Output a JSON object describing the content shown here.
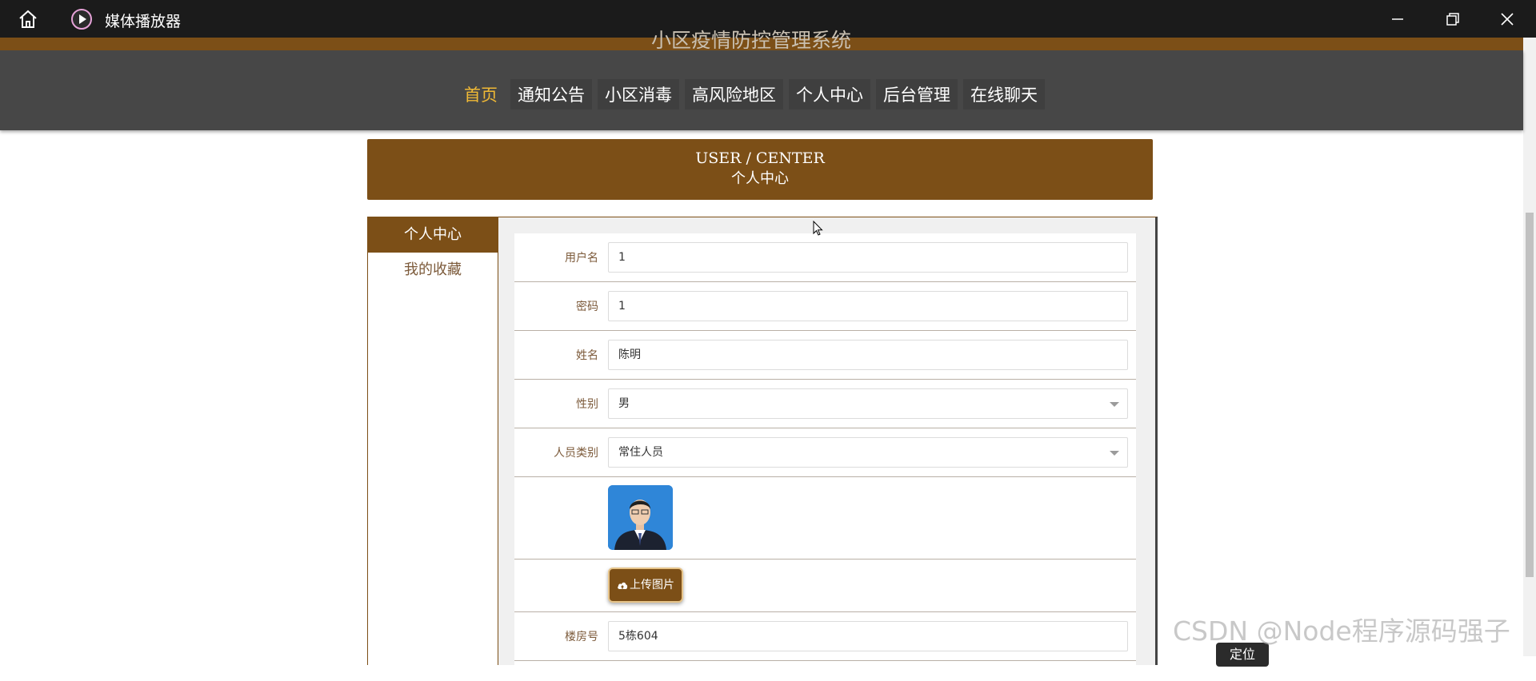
{
  "window": {
    "title": "媒体播放器"
  },
  "site": {
    "title": "小区疫情防控管理系统",
    "nav": [
      {
        "label": "首页",
        "active": true
      },
      {
        "label": "通知公告",
        "active": false
      },
      {
        "label": "小区消毒",
        "active": false
      },
      {
        "label": "高风险地区",
        "active": false
      },
      {
        "label": "个人中心",
        "active": false
      },
      {
        "label": "后台管理",
        "active": false
      },
      {
        "label": "在线聊天",
        "active": false
      }
    ],
    "accent_color": "#7c4f17",
    "nav_active_color": "#f0b935"
  },
  "banner": {
    "en": "USER / CENTER",
    "zh": "个人中心"
  },
  "sidebar": {
    "items": [
      {
        "label": "个人中心",
        "active": true
      },
      {
        "label": "我的收藏",
        "active": false
      }
    ]
  },
  "form": {
    "username": {
      "label": "用户名",
      "value": "1"
    },
    "password": {
      "label": "密码",
      "value": "1"
    },
    "name": {
      "label": "姓名",
      "value": "陈明"
    },
    "gender": {
      "label": "性别",
      "value": "男"
    },
    "person_type": {
      "label": "人员类别",
      "value": "常住人员"
    },
    "upload_label": "上传图片",
    "building": {
      "label": "楼房号",
      "value": "5栋604"
    }
  },
  "watermark": "CSDN @Node程序源码强子",
  "float_button": "定位"
}
